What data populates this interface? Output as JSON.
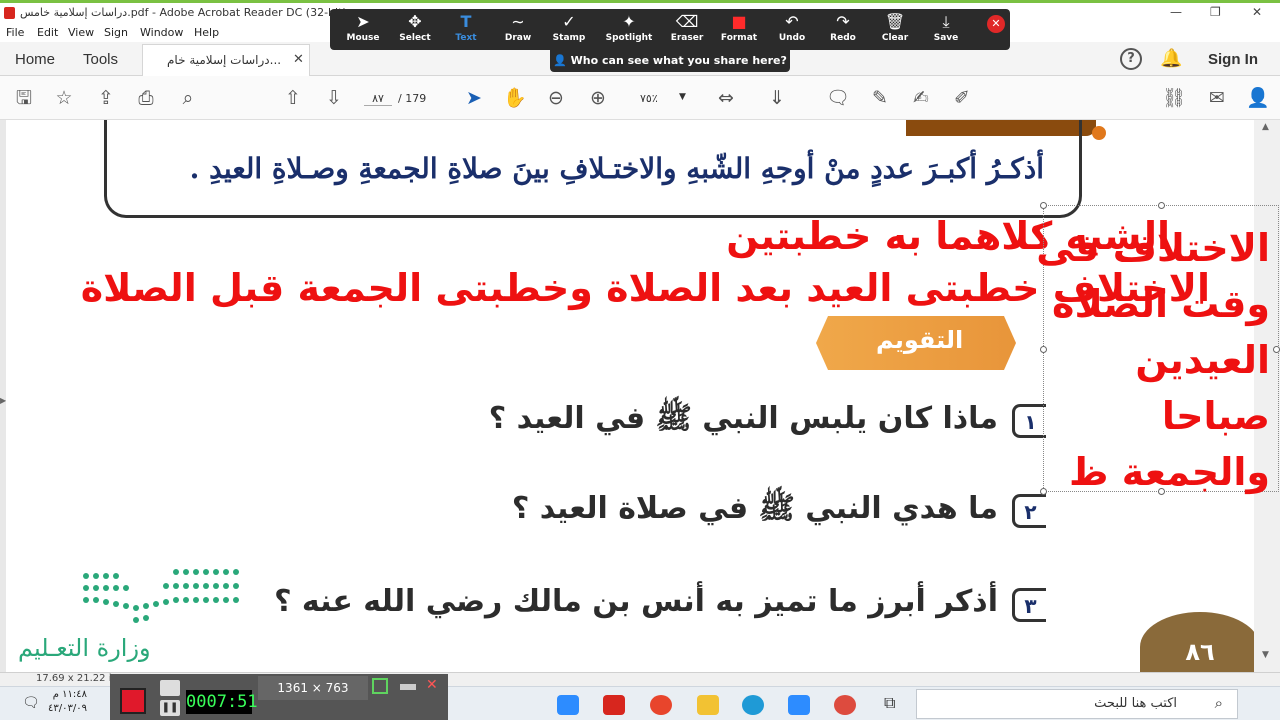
{
  "window": {
    "title": "دراسات إسلامية خامس.pdf - Adobe Acrobat Reader DC (32-bit)",
    "min": "—",
    "max": "❐",
    "close": "✕"
  },
  "menu": [
    "File",
    "Edit",
    "View",
    "Sign",
    "Window",
    "Help"
  ],
  "tabs": {
    "home": "Home",
    "tools": "Tools",
    "doc": "دراسات إسلامية خام...",
    "close": "✕",
    "sign_in": "Sign In"
  },
  "toolbar": {
    "current_page": "٨٧",
    "total_pages": "/  179",
    "zoom": "٧٥٪"
  },
  "zoom_tools": [
    {
      "label": "Mouse",
      "icon": "➤"
    },
    {
      "label": "Select",
      "icon": "✥"
    },
    {
      "label": "Text",
      "icon": "T"
    },
    {
      "label": "Draw",
      "icon": "∼"
    },
    {
      "label": "Stamp",
      "icon": "✓"
    },
    {
      "label": "Spotlight",
      "icon": "✦"
    },
    {
      "label": "Eraser",
      "icon": "⌫"
    },
    {
      "label": "Format",
      "icon": "■"
    },
    {
      "label": "Undo",
      "icon": "↶"
    },
    {
      "label": "Redo",
      "icon": "↷"
    },
    {
      "label": "Clear",
      "icon": "🗑"
    },
    {
      "label": "Save",
      "icon": "⤓"
    }
  ],
  "zoom_share": "Who can see what you share here?",
  "doc": {
    "question": "أذكـرُ أكبـرَ عددٍ منْ أوجهِ الشّبهِ والاختـلافِ بينَ صلاةِ الجمعةِ وصـلاةِ العيدِ .",
    "answer_line1": "الشبه كلاهما به خطبتين",
    "answer_line2": "الاختلاف خطبتى العيد بعد الصلاة وخطبتى الجمعة قبل الصلاة",
    "badge": "التقويم",
    "q1_num": "١",
    "q1": "ماذا كان يلبس النبي ﷺ في العيد ؟",
    "q2_num": "٢",
    "q2": "ما هدي النبي ﷺ في صلاة العيد ؟",
    "q3_num": "٣",
    "q3": "أذكر أبرز ما تميز به أنس بن مالك رضي الله عنه ؟",
    "note_lines": [
      "الاختلاف فى",
      "وقت الصلاة",
      "العيدين",
      "صباحا",
      "والجمعة ظ"
    ],
    "logo_text": "وزارة التعـليم",
    "page_number": "٨٦"
  },
  "status": {
    "size": "17.69 x 21.22 in"
  },
  "recorder": {
    "timer": "0007:51",
    "resolution": "1361 × 763"
  },
  "taskbar": {
    "time": "١١:٤٨ م",
    "date": "٤٣/٠٣/٠٩",
    "search_placeholder": "اكتب هنا للبحث"
  },
  "colors": {
    "annotation_red": "#ee1111",
    "question_blue": "#1a2f6b",
    "badge_orange": "#e8953a",
    "logo_green": "#2aa87a"
  }
}
